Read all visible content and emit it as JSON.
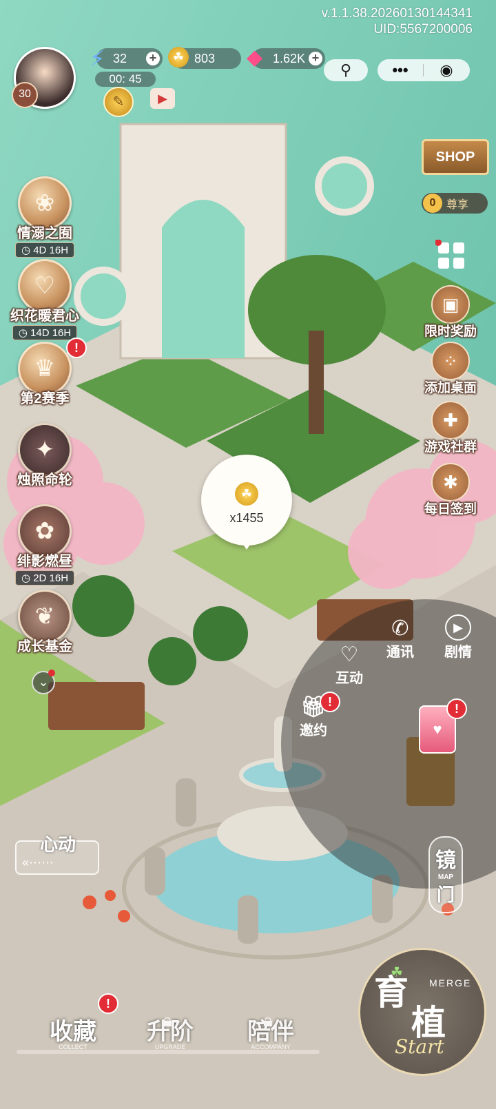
{
  "header": {
    "version": "v.1.1.38.20260130144341",
    "uid": "UID:5567200006",
    "player_level": "30",
    "energy": "32",
    "energy_timer": "00: 45",
    "coins": "803",
    "gems": "1.62K"
  },
  "left_menu": [
    {
      "label": "情溺之囿",
      "timer": "4D 16H",
      "icon": "tulip-icon"
    },
    {
      "label": "织花暖君心",
      "timer": "14D 16H",
      "icon": "heart-box-icon"
    },
    {
      "label": "第2赛季",
      "timer": "",
      "icon": "crown-shield-icon"
    },
    {
      "label": "烛照命轮",
      "timer": "",
      "icon": "compass-star-icon"
    },
    {
      "label": "绯影燃昼",
      "timer": "2D 16H",
      "icon": "flower-icon"
    },
    {
      "label": "成长基金",
      "timer": "",
      "icon": "leaf-icon"
    }
  ],
  "right_menu": {
    "shop": "SHOP",
    "vip_level": "0",
    "vip_label": "尊享",
    "items": [
      {
        "label": "限时奖励",
        "icon": "gift-bag-icon"
      },
      {
        "label": "添加桌面",
        "icon": "add-desktop-icon"
      },
      {
        "label": "游戏社群",
        "icon": "gamepad-icon"
      },
      {
        "label": "每日签到",
        "icon": "calendar-icon"
      }
    ]
  },
  "bubble": {
    "amount": "x1455"
  },
  "wheel": {
    "contact": "通讯",
    "story": "剧情",
    "interact": "互动",
    "invite": "邀约"
  },
  "heart_button": "心动",
  "mirror_gate": {
    "label_top": "镜",
    "label_bottom": "门",
    "sub": "MAP"
  },
  "merge_button": {
    "main_top": "育",
    "main_bottom": "植",
    "sub": "MERGE",
    "start": "Start"
  },
  "bottom_tabs": [
    {
      "label": "收藏",
      "sub": "COLLECT",
      "locked": false,
      "badge": "!"
    },
    {
      "label": "升阶",
      "sub": "UPGRADE",
      "locked": true
    },
    {
      "label": "陪伴",
      "sub": "ACCOMPANY",
      "locked": true
    }
  ],
  "colors": {
    "badge": "#e22c36",
    "water": "#7fcfb8",
    "wood": "#9a6039"
  }
}
